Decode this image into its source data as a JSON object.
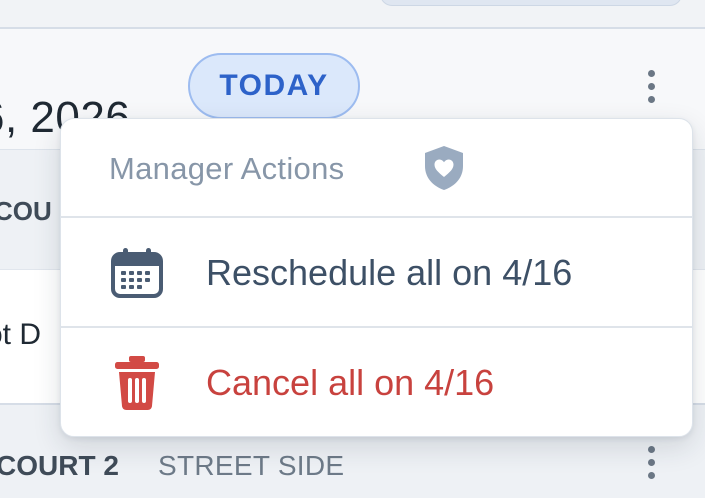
{
  "header": {
    "date_text": "6, 2026",
    "today_badge": "TODAY"
  },
  "rows": {
    "court_header_label": "COU",
    "slot_label": "ot D",
    "court2_name": "COURT 2",
    "court2_subtitle": "STREET SIDE"
  },
  "menu": {
    "header_label": "Manager Actions",
    "header_icon": "shield-heart-icon",
    "items": [
      {
        "label": "Reschedule all on 4/16",
        "icon": "calendar-icon",
        "color": "#3d5066"
      },
      {
        "label": "Cancel all on 4/16",
        "icon": "trash-icon",
        "color": "#c8423e"
      }
    ]
  },
  "colors": {
    "badge_background": "#dbe8fb",
    "badge_text": "#2d62c9",
    "danger": "#c8423e",
    "muted": "#8796a8"
  }
}
